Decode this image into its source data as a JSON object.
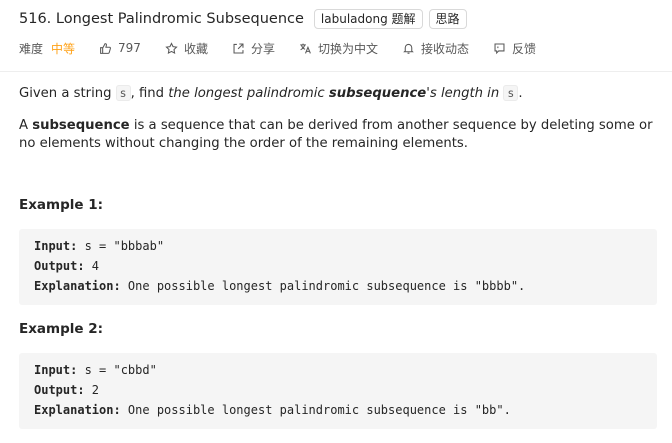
{
  "problem": {
    "title": "516. Longest Palindromic Subsequence",
    "tags": [
      "labuladong 题解",
      "思路"
    ]
  },
  "meta": {
    "difficulty_label": "难度",
    "difficulty_value": "中等",
    "likes": "797",
    "favorite": "收藏",
    "share": "分享",
    "translate": "切换为中文",
    "subscribe": "接收动态",
    "feedback": "反馈"
  },
  "description": {
    "p1": {
      "t1": "Given a string ",
      "code1": "s",
      "t2": ", find ",
      "t3": "the longest palindromic ",
      "t4": "subsequence",
      "t5": "'s length in ",
      "code2": "s",
      "t6": "."
    },
    "p2": {
      "t1": "A ",
      "bold": "subsequence",
      "t2": " is a sequence that can be derived from another sequence by deleting some or no elements without changing the order of the remaining elements."
    }
  },
  "examples": [
    {
      "title": "Example 1:",
      "input_label": "Input:",
      "input_value": " s = \"bbbab\"",
      "output_label": "Output:",
      "output_value": " 4",
      "explanation_label": "Explanation:",
      "explanation_value": " One possible longest palindromic subsequence is \"bbbb\"."
    },
    {
      "title": "Example 2:",
      "input_label": "Input:",
      "input_value": " s = \"cbbd\"",
      "output_label": "Output:",
      "output_value": " 2",
      "explanation_label": "Explanation:",
      "explanation_value": " One possible longest palindromic subsequence is \"bb\"."
    }
  ],
  "colors": {
    "difficulty_medium": "#ffa116",
    "code_bg": "#f5f5f5"
  },
  "icons": [
    "thumbs-up-icon",
    "star-icon",
    "share-icon",
    "translate-icon",
    "bell-icon",
    "feedback-icon"
  ]
}
